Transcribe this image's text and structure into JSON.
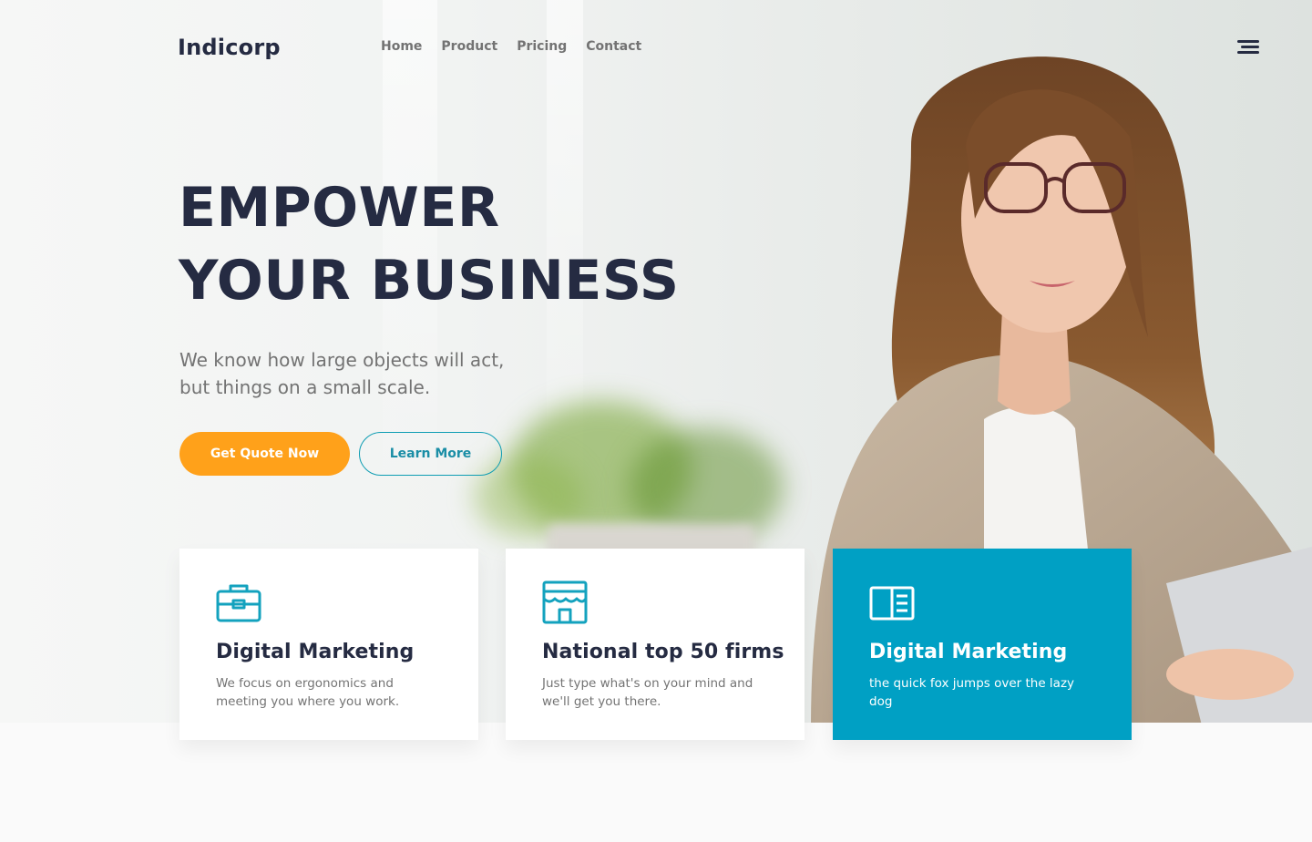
{
  "brand": {
    "name": "Indicorp"
  },
  "nav": {
    "items": [
      "Home",
      "Product",
      "Pricing",
      "Contact"
    ],
    "menu_icon": "hamburger-menu-icon"
  },
  "hero": {
    "title_line1": "EMPOWER",
    "title_line2": "YOUR BUSINESS",
    "subtitle_line1": "We know how large objects will act,",
    "subtitle_line2": "but things on a small scale.",
    "primary_button": "Get Quote Now",
    "secondary_button": "Learn More"
  },
  "cards": [
    {
      "icon": "briefcase-icon",
      "title": "Digital Marketing",
      "text": "We focus on ergonomics and meeting you where you work."
    },
    {
      "icon": "storefront-icon",
      "title": "National top 50 firms",
      "text": "Just type what's on your mind and we'll get you there."
    },
    {
      "icon": "book-open-icon",
      "title": "Digital Marketing",
      "text": "the quick fox jumps over the lazy dog"
    }
  ],
  "colors": {
    "primary_text": "#252b42",
    "muted_text": "#737373",
    "accent_orange": "#ffa11a",
    "accent_teal": "#00a0c4"
  }
}
